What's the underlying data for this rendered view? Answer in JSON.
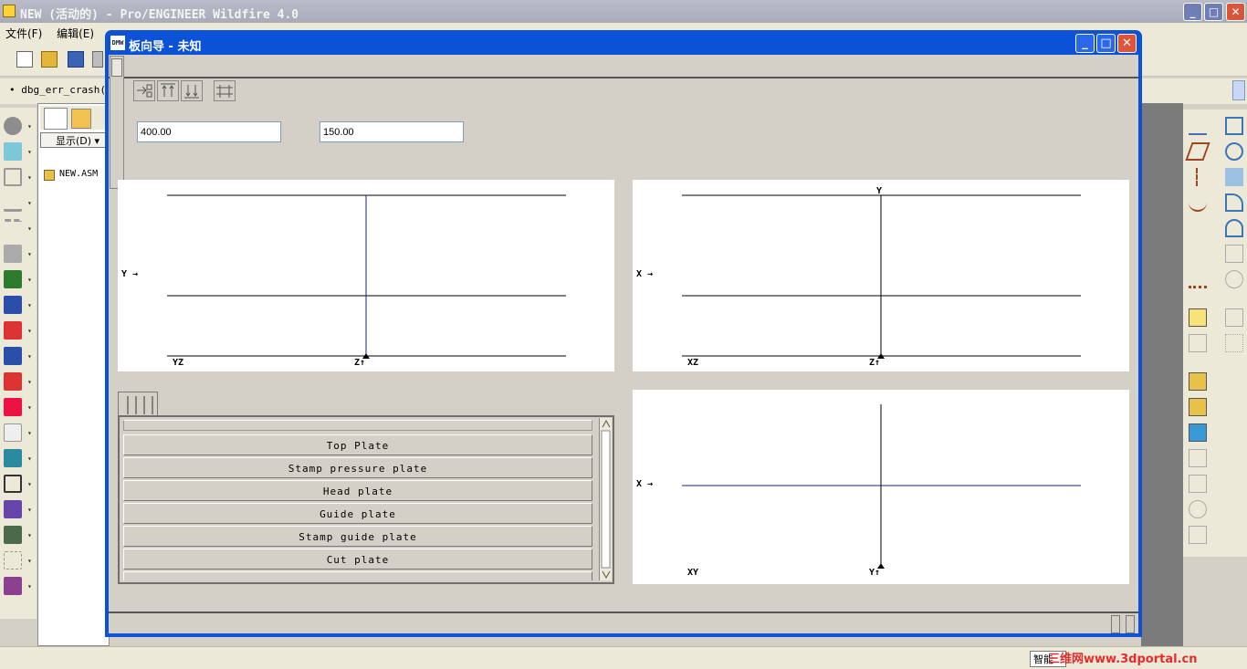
{
  "window": {
    "title": "NEW (活动的) - Pro/ENGINEER Wildfire 4.0",
    "controls": {
      "minimize": "_",
      "maximize": "□",
      "close": "✕"
    }
  },
  "menubar": {
    "items": [
      "文件(F)",
      "编辑(E)"
    ]
  },
  "message_area": {
    "text": "• dbg_err_crash()"
  },
  "model_tree": {
    "show_button": "显示(D) ▾",
    "item": "NEW.ASM"
  },
  "status_bar": {
    "smart_filter": "智能",
    "watermark": "三维网www.3dportal.cn"
  },
  "dialog": {
    "title": "板向导 - 未知",
    "icon_text": "DMW",
    "controls": {
      "minimize": "_",
      "maximize": "□",
      "close": "✕"
    },
    "inputs": {
      "value1": "400.00",
      "value2": "150.00"
    },
    "views": {
      "yz": {
        "side_axis": "Y →",
        "corner": "YZ",
        "bottom_axis": "Z↑"
      },
      "xz": {
        "side_axis": "X →",
        "corner": "XZ",
        "bottom_axis": "Z↑",
        "top_axis": "Y"
      },
      "xy": {
        "side_axis": "X →",
        "corner": "XY",
        "bottom_axis": "Y↑"
      }
    },
    "plate_list": [
      "Top Plate",
      "Stamp pressure plate",
      "Head plate",
      "Guide plate",
      "Stamp guide plate",
      "Cut plate"
    ]
  }
}
